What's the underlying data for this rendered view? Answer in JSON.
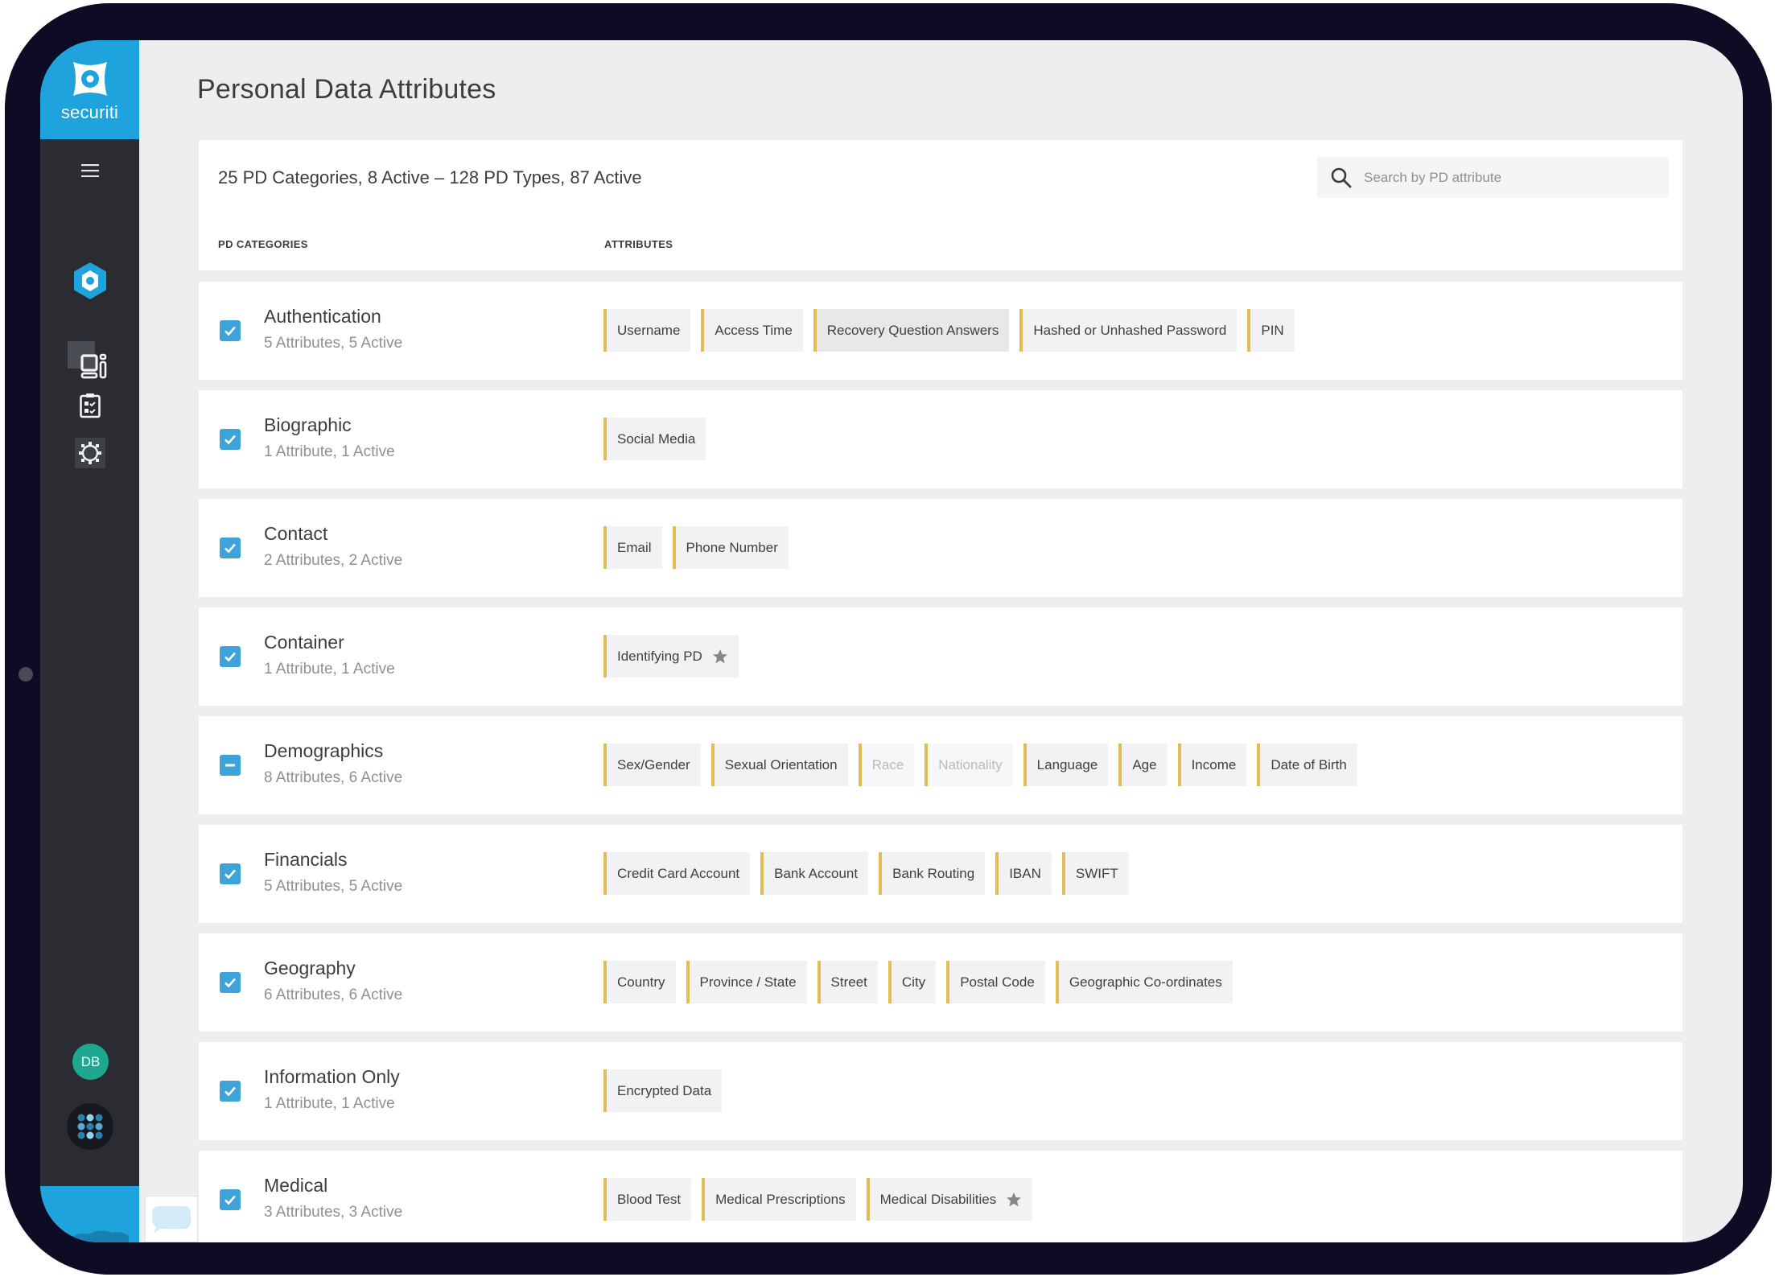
{
  "brand": {
    "name": "securiti",
    "accent": "#1fa3dc",
    "chip_accent": "#e2bd57",
    "checkbox": "#3ea3d8"
  },
  "sidebar": {
    "menu_icon": "hamburger-icon",
    "items": [
      {
        "name": "privacy-hex",
        "icon": "hex-icon",
        "active": true
      },
      {
        "name": "dashboard",
        "icon": "dashboard-icon"
      },
      {
        "name": "assessments",
        "icon": "clipboard-icon"
      },
      {
        "name": "settings",
        "icon": "gear-icon"
      }
    ],
    "avatar_initials": "DB",
    "apps_icon": "apps-grid-icon"
  },
  "page": {
    "title": "Personal Data Attributes"
  },
  "header": {
    "summary": "25 PD Categories, 8 Active  –  128 PD Types, 87 Active",
    "search_placeholder": "Search by PD attribute",
    "search_value": "",
    "col_categories": "PD CATEGORIES",
    "col_attributes": "ATTRIBUTES"
  },
  "categories": [
    {
      "name": "Authentication",
      "summary": "5 Attributes, 5 Active",
      "state": "checked",
      "attributes": [
        {
          "label": "Username",
          "active": true
        },
        {
          "label": "Access Time",
          "active": true
        },
        {
          "label": "Recovery Question Answers",
          "active": true,
          "hover": true
        },
        {
          "label": "Hashed or Unhashed Password",
          "active": true
        },
        {
          "label": "PIN",
          "active": true
        }
      ]
    },
    {
      "name": "Biographic",
      "summary": "1 Attribute, 1 Active",
      "state": "checked",
      "attributes": [
        {
          "label": "Social Media",
          "active": true
        }
      ]
    },
    {
      "name": "Contact",
      "summary": "2 Attributes, 2 Active",
      "state": "checked",
      "attributes": [
        {
          "label": "Email",
          "active": true
        },
        {
          "label": "Phone Number",
          "active": true
        }
      ]
    },
    {
      "name": "Container",
      "summary": "1 Attribute, 1 Active",
      "state": "checked",
      "attributes": [
        {
          "label": "Identifying PD",
          "active": true,
          "starred": true
        }
      ]
    },
    {
      "name": "Demographics",
      "summary": "8 Attributes, 6 Active",
      "state": "partial",
      "attributes": [
        {
          "label": "Sex/Gender",
          "active": true
        },
        {
          "label": "Sexual Orientation",
          "active": true
        },
        {
          "label": "Race",
          "active": false
        },
        {
          "label": "Nationality",
          "active": false
        },
        {
          "label": "Language",
          "active": true
        },
        {
          "label": "Age",
          "active": true
        },
        {
          "label": "Income",
          "active": true
        },
        {
          "label": "Date of Birth",
          "active": true
        }
      ]
    },
    {
      "name": "Financials",
      "summary": "5 Attributes, 5 Active",
      "state": "checked",
      "attributes": [
        {
          "label": "Credit Card Account",
          "active": true
        },
        {
          "label": "Bank Account",
          "active": true
        },
        {
          "label": "Bank Routing",
          "active": true
        },
        {
          "label": "IBAN",
          "active": true
        },
        {
          "label": "SWIFT",
          "active": true
        }
      ]
    },
    {
      "name": "Geography",
      "summary": "6 Attributes, 6 Active",
      "state": "checked",
      "attributes": [
        {
          "label": "Country",
          "active": true
        },
        {
          "label": "Province / State",
          "active": true
        },
        {
          "label": "Street",
          "active": true
        },
        {
          "label": "City",
          "active": true
        },
        {
          "label": "Postal Code",
          "active": true
        },
        {
          "label": "Geographic Co-ordinates",
          "active": true
        }
      ]
    },
    {
      "name": "Information Only",
      "summary": "1 Attribute, 1 Active",
      "state": "checked",
      "attributes": [
        {
          "label": "Encrypted Data",
          "active": true
        }
      ]
    },
    {
      "name": "Medical",
      "summary": "3 Attributes, 3 Active",
      "state": "checked",
      "attributes": [
        {
          "label": "Blood Test",
          "active": true
        },
        {
          "label": "Medical Prescriptions",
          "active": true
        },
        {
          "label": "Medical Disabilities",
          "active": true,
          "starred": true
        }
      ]
    }
  ]
}
